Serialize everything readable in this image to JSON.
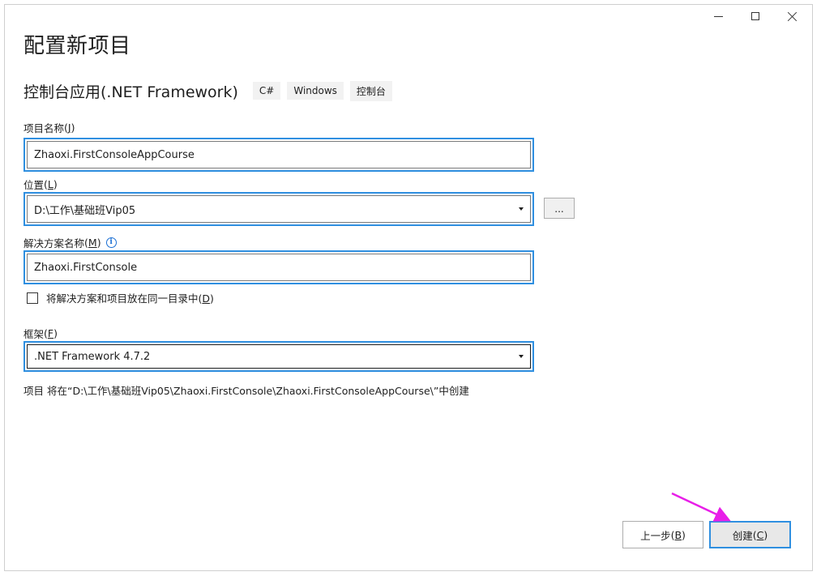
{
  "window": {
    "title": "配置新项目",
    "controls": {
      "minimize": "minimize-icon",
      "maximize": "maximize-icon",
      "close": "close-icon"
    }
  },
  "project_type": {
    "name": "控制台应用(.NET Framework)",
    "tags": [
      "C#",
      "Windows",
      "控制台"
    ]
  },
  "fields": {
    "project_name": {
      "label": "项目名称",
      "accel": "J",
      "value": "Zhaoxi.FirstConsoleAppCourse"
    },
    "location": {
      "label": "位置",
      "accel": "L",
      "value": "D:\\工作\\基础班Vip05",
      "browse": "..."
    },
    "solution_name": {
      "label": "解决方案名称",
      "accel": "M",
      "value": "Zhaoxi.FirstConsole",
      "info_icon": "info-icon"
    },
    "same_dir": {
      "label": "将解决方案和项目放在同一目录中",
      "accel": "D",
      "checked": false
    },
    "framework": {
      "label": "框架",
      "accel": "F",
      "value": ".NET Framework 4.7.2"
    }
  },
  "path_info": "项目 将在“D:\\工作\\基础班Vip05\\Zhaoxi.FirstConsole\\Zhaoxi.FirstConsoleAppCourse\\”中创建",
  "buttons": {
    "back": {
      "label": "上一步",
      "accel": "B"
    },
    "create": {
      "label": "创建",
      "accel": "C"
    }
  },
  "colors": {
    "focus_border": "#2f8fe0",
    "annotation_arrow": "#e81ee8"
  }
}
